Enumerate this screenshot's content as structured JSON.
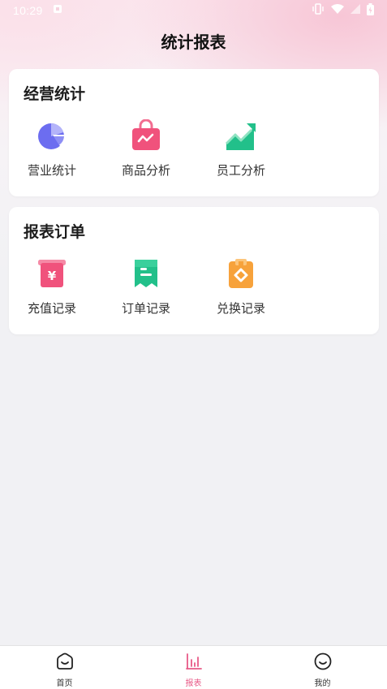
{
  "status_bar": {
    "time": "10:29"
  },
  "page": {
    "title": "统计报表"
  },
  "sections": [
    {
      "title": "经营统计",
      "items": [
        {
          "label": "营业统计",
          "icon": "pie-chart-icon",
          "color": "#6c6df0"
        },
        {
          "label": "商品分析",
          "icon": "shopping-bag-icon",
          "color": "#f0527c"
        },
        {
          "label": "员工分析",
          "icon": "trend-up-icon",
          "color": "#22c08a"
        }
      ]
    },
    {
      "title": "报表订单",
      "items": [
        {
          "label": "充值记录",
          "icon": "recharge-icon",
          "color": "#f0527c"
        },
        {
          "label": "订单记录",
          "icon": "receipt-icon",
          "color": "#22c08a"
        },
        {
          "label": "兑换记录",
          "icon": "exchange-voucher-icon",
          "color": "#f7a23b"
        }
      ]
    }
  ],
  "tabbar": {
    "tabs": [
      {
        "label": "首页",
        "icon": "home-icon"
      },
      {
        "label": "报表",
        "icon": "bar-chart-icon",
        "active": true
      },
      {
        "label": "我的",
        "icon": "profile-icon"
      }
    ],
    "active_color": "#e85a87"
  }
}
